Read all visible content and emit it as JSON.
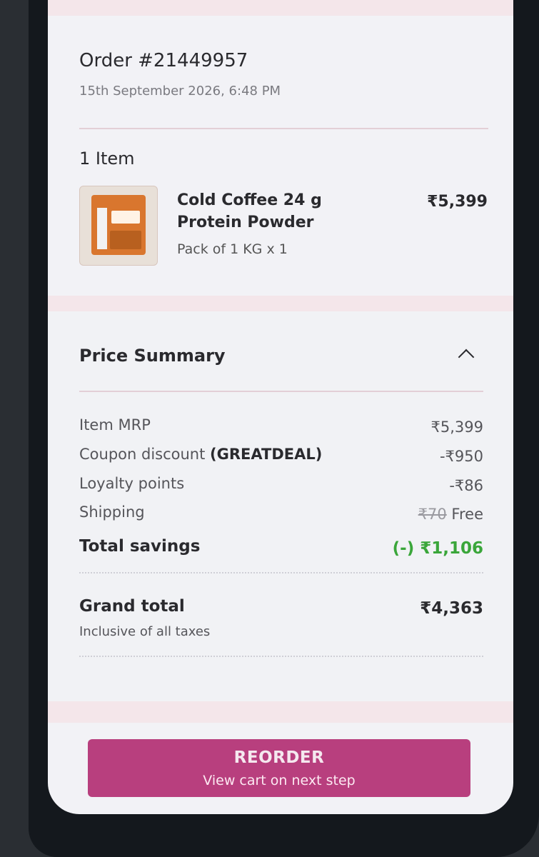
{
  "order": {
    "number": "Order #21449957",
    "date": "15th September 2026, 6:48 PM"
  },
  "items": {
    "count_label": "1 Item",
    "list": [
      {
        "name": "Cold Coffee 24 g Protein Powder",
        "variant": "Pack of 1 KG x 1",
        "price": "₹5,399"
      }
    ]
  },
  "price_summary": {
    "title": "Price Summary",
    "rows": {
      "item_mrp": {
        "label": "Item MRP",
        "value": "₹5,399"
      },
      "coupon": {
        "label": "Coupon discount",
        "code": "(GREATDEAL)",
        "value": "-₹950"
      },
      "loyalty": {
        "label": "Loyalty points",
        "value": "-₹86"
      },
      "shipping": {
        "label": "Shipping",
        "original": "₹70",
        "value": "Free"
      }
    },
    "total_savings": {
      "label": "Total savings",
      "value": "(-) ₹1,106"
    },
    "grand_total": {
      "label": "Grand total",
      "value": "₹4,363",
      "note": "Inclusive of all taxes"
    }
  },
  "reorder": {
    "label": "REORDER",
    "sublabel": "View cart on next step"
  },
  "colors": {
    "accent": "#b83f7e",
    "savings_green": "#3aa63a",
    "divider_pink": "#e3cfd6",
    "band_pink": "#f4e6ea"
  }
}
